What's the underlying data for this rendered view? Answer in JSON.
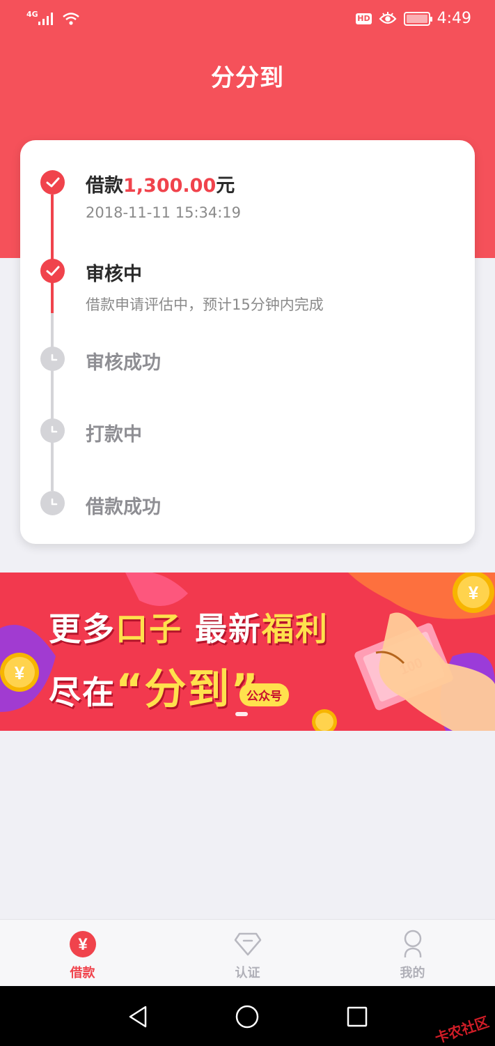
{
  "status_bar": {
    "network": "4G",
    "hd_label": "HD",
    "time": "4:49"
  },
  "app": {
    "title": "分分到"
  },
  "progress": {
    "steps": [
      {
        "title_prefix": "借款",
        "amount": "1,300.00",
        "title_suffix": "元",
        "subtitle": "2018-11-11 15:34:19",
        "status": "done"
      },
      {
        "title": "审核中",
        "subtitle": "借款申请评估中，预计15分钟内完成",
        "status": "done"
      },
      {
        "title": "审核成功",
        "status": "pending"
      },
      {
        "title": "打款中",
        "status": "pending"
      },
      {
        "title": "借款成功",
        "status": "pending"
      }
    ]
  },
  "banner": {
    "line1_a": "更多",
    "line1_b": "口子",
    "line1_c": " 最新",
    "line1_d": "福利",
    "line2_a": "尽在",
    "line2_b": "“分到”",
    "badge": "公众号",
    "coin_symbol": "¥",
    "note_value": "100"
  },
  "tab_bar": {
    "tabs": [
      {
        "label": "借款",
        "icon": "yen-icon",
        "active": true
      },
      {
        "label": "认证",
        "icon": "diamond-icon",
        "active": false
      },
      {
        "label": "我的",
        "icon": "user-icon",
        "active": false
      }
    ],
    "yen_symbol": "¥"
  },
  "watermark": "卡农社区",
  "colors": {
    "primary_red": "#f5515a",
    "accent_red": "#f0434c",
    "pending_gray": "#d4d4d8",
    "highlight_yellow": "#ffe14d"
  }
}
